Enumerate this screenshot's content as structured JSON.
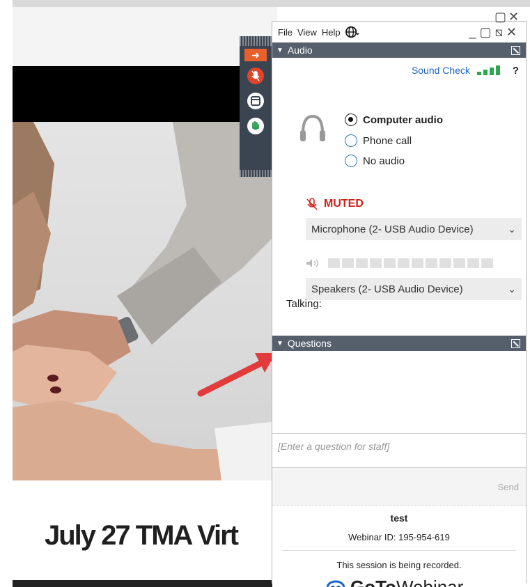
{
  "slide": {
    "title": "July 27 TMA Virt"
  },
  "outer_window": {
    "controls": "▢✕"
  },
  "panel": {
    "menu": {
      "file": "File",
      "view": "View",
      "help": "Help",
      "globe_icon": "globe-icon",
      "window_controls": "_▢⧅✕"
    },
    "audio": {
      "header": "Audio",
      "sound_check": "Sound Check",
      "help": "?",
      "options": [
        {
          "label": "Computer audio",
          "selected": true
        },
        {
          "label": "Phone call",
          "selected": false
        },
        {
          "label": "No audio",
          "selected": false
        }
      ],
      "muted": "MUTED",
      "microphone": "Microphone (2- USB Audio Device)",
      "speakers": "Speakers (2- USB Audio Device)",
      "talking": "Talking:",
      "signal_color": "#2aa84a",
      "muted_color": "#d0201a"
    },
    "questions": {
      "header": "Questions",
      "placeholder": "[Enter a question for staff]",
      "send": "Send"
    },
    "footer": {
      "title": "test",
      "webinar_id": "Webinar ID: 195-954-619",
      "recorded": "This session is being recorded.",
      "brand_goto": "GoTo",
      "brand_webinar": "Webinar"
    }
  },
  "control_bar": {
    "buttons": [
      "arrow-right-icon",
      "microphone-muted-icon",
      "screen-icon",
      "raise-hand-icon"
    ],
    "arrow_color": "#e8612c"
  }
}
